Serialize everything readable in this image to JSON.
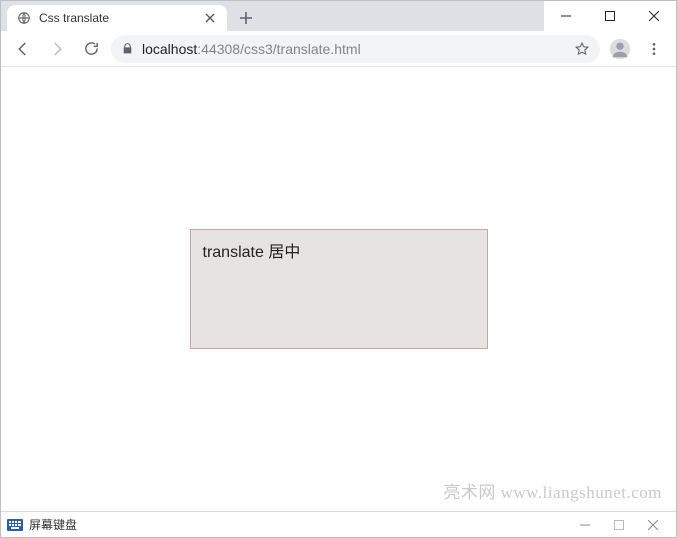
{
  "window": {
    "tab_title": "Css translate",
    "new_tab_tooltip": "New tab"
  },
  "win_controls": {
    "min": "minimize",
    "max": "maximize",
    "close": "close"
  },
  "toolbar": {
    "back": "back",
    "forward": "forward",
    "reload": "reload",
    "star": "bookmark",
    "account": "account",
    "menu": "menu"
  },
  "omnibox": {
    "host": "localhost",
    "port_path": ":44308/css3/translate.html"
  },
  "page": {
    "box_text": "translate 居中",
    "watermark": "亮术网 www.liangshunet.com"
  },
  "osk": {
    "label": "屏幕键盘"
  }
}
